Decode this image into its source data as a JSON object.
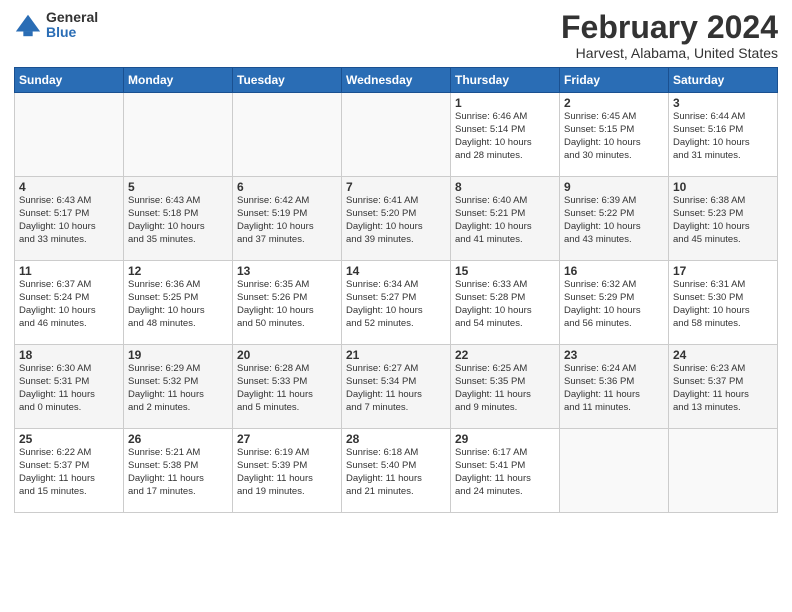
{
  "header": {
    "logo_general": "General",
    "logo_blue": "Blue",
    "month": "February 2024",
    "location": "Harvest, Alabama, United States"
  },
  "days_of_week": [
    "Sunday",
    "Monday",
    "Tuesday",
    "Wednesday",
    "Thursday",
    "Friday",
    "Saturday"
  ],
  "weeks": [
    [
      {
        "day": "",
        "info": ""
      },
      {
        "day": "",
        "info": ""
      },
      {
        "day": "",
        "info": ""
      },
      {
        "day": "",
        "info": ""
      },
      {
        "day": "1",
        "info": "Sunrise: 6:46 AM\nSunset: 5:14 PM\nDaylight: 10 hours\nand 28 minutes."
      },
      {
        "day": "2",
        "info": "Sunrise: 6:45 AM\nSunset: 5:15 PM\nDaylight: 10 hours\nand 30 minutes."
      },
      {
        "day": "3",
        "info": "Sunrise: 6:44 AM\nSunset: 5:16 PM\nDaylight: 10 hours\nand 31 minutes."
      }
    ],
    [
      {
        "day": "4",
        "info": "Sunrise: 6:43 AM\nSunset: 5:17 PM\nDaylight: 10 hours\nand 33 minutes."
      },
      {
        "day": "5",
        "info": "Sunrise: 6:43 AM\nSunset: 5:18 PM\nDaylight: 10 hours\nand 35 minutes."
      },
      {
        "day": "6",
        "info": "Sunrise: 6:42 AM\nSunset: 5:19 PM\nDaylight: 10 hours\nand 37 minutes."
      },
      {
        "day": "7",
        "info": "Sunrise: 6:41 AM\nSunset: 5:20 PM\nDaylight: 10 hours\nand 39 minutes."
      },
      {
        "day": "8",
        "info": "Sunrise: 6:40 AM\nSunset: 5:21 PM\nDaylight: 10 hours\nand 41 minutes."
      },
      {
        "day": "9",
        "info": "Sunrise: 6:39 AM\nSunset: 5:22 PM\nDaylight: 10 hours\nand 43 minutes."
      },
      {
        "day": "10",
        "info": "Sunrise: 6:38 AM\nSunset: 5:23 PM\nDaylight: 10 hours\nand 45 minutes."
      }
    ],
    [
      {
        "day": "11",
        "info": "Sunrise: 6:37 AM\nSunset: 5:24 PM\nDaylight: 10 hours\nand 46 minutes."
      },
      {
        "day": "12",
        "info": "Sunrise: 6:36 AM\nSunset: 5:25 PM\nDaylight: 10 hours\nand 48 minutes."
      },
      {
        "day": "13",
        "info": "Sunrise: 6:35 AM\nSunset: 5:26 PM\nDaylight: 10 hours\nand 50 minutes."
      },
      {
        "day": "14",
        "info": "Sunrise: 6:34 AM\nSunset: 5:27 PM\nDaylight: 10 hours\nand 52 minutes."
      },
      {
        "day": "15",
        "info": "Sunrise: 6:33 AM\nSunset: 5:28 PM\nDaylight: 10 hours\nand 54 minutes."
      },
      {
        "day": "16",
        "info": "Sunrise: 6:32 AM\nSunset: 5:29 PM\nDaylight: 10 hours\nand 56 minutes."
      },
      {
        "day": "17",
        "info": "Sunrise: 6:31 AM\nSunset: 5:30 PM\nDaylight: 10 hours\nand 58 minutes."
      }
    ],
    [
      {
        "day": "18",
        "info": "Sunrise: 6:30 AM\nSunset: 5:31 PM\nDaylight: 11 hours\nand 0 minutes."
      },
      {
        "day": "19",
        "info": "Sunrise: 6:29 AM\nSunset: 5:32 PM\nDaylight: 11 hours\nand 2 minutes."
      },
      {
        "day": "20",
        "info": "Sunrise: 6:28 AM\nSunset: 5:33 PM\nDaylight: 11 hours\nand 5 minutes."
      },
      {
        "day": "21",
        "info": "Sunrise: 6:27 AM\nSunset: 5:34 PM\nDaylight: 11 hours\nand 7 minutes."
      },
      {
        "day": "22",
        "info": "Sunrise: 6:25 AM\nSunset: 5:35 PM\nDaylight: 11 hours\nand 9 minutes."
      },
      {
        "day": "23",
        "info": "Sunrise: 6:24 AM\nSunset: 5:36 PM\nDaylight: 11 hours\nand 11 minutes."
      },
      {
        "day": "24",
        "info": "Sunrise: 6:23 AM\nSunset: 5:37 PM\nDaylight: 11 hours\nand 13 minutes."
      }
    ],
    [
      {
        "day": "25",
        "info": "Sunrise: 6:22 AM\nSunset: 5:37 PM\nDaylight: 11 hours\nand 15 minutes."
      },
      {
        "day": "26",
        "info": "Sunrise: 5:21 AM\nSunset: 5:38 PM\nDaylight: 11 hours\nand 17 minutes."
      },
      {
        "day": "27",
        "info": "Sunrise: 6:19 AM\nSunset: 5:39 PM\nDaylight: 11 hours\nand 19 minutes."
      },
      {
        "day": "28",
        "info": "Sunrise: 6:18 AM\nSunset: 5:40 PM\nDaylight: 11 hours\nand 21 minutes."
      },
      {
        "day": "29",
        "info": "Sunrise: 6:17 AM\nSunset: 5:41 PM\nDaylight: 11 hours\nand 24 minutes."
      },
      {
        "day": "",
        "info": ""
      },
      {
        "day": "",
        "info": ""
      }
    ]
  ]
}
